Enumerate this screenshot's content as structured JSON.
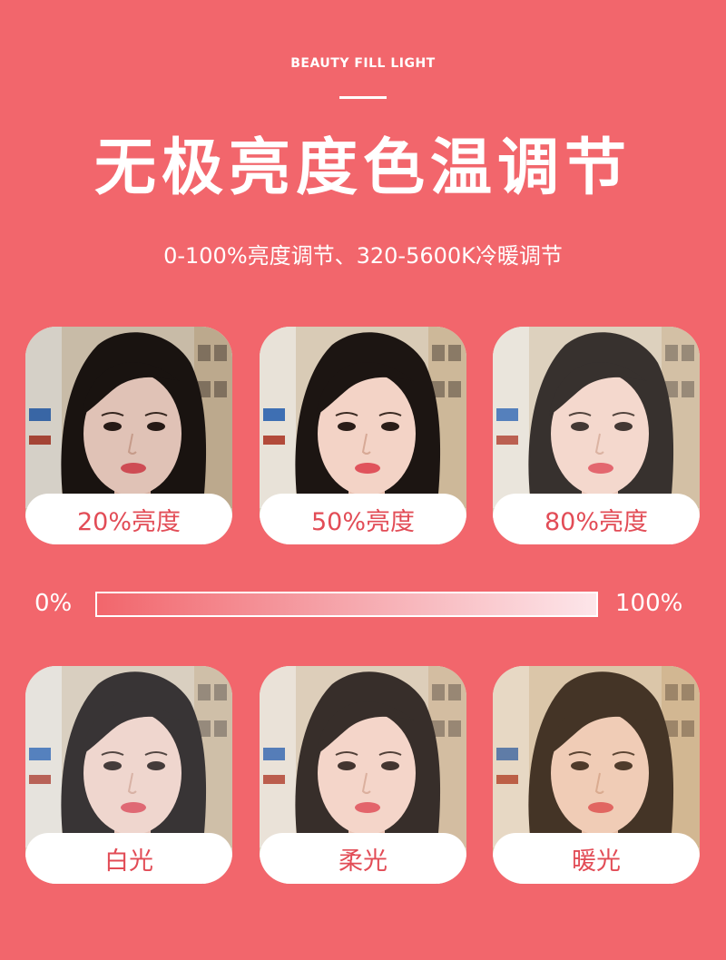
{
  "header": {
    "eyebrow": "BEAUTY FILL LIGHT",
    "title": "无极亮度色温调节",
    "subtitle": "0-100%亮度调节、320-5600K冷暖调节"
  },
  "brightness_cards": [
    {
      "label": "20%亮度"
    },
    {
      "label": "50%亮度"
    },
    {
      "label": "80%亮度"
    }
  ],
  "brightness_scale": {
    "min_label": "0%",
    "max_label": "100%"
  },
  "tone_cards": [
    {
      "label": "白光"
    },
    {
      "label": "柔光"
    },
    {
      "label": "暖光"
    }
  ],
  "colors": {
    "background": "#f2666c",
    "label_text": "#e24c56",
    "white": "#ffffff"
  }
}
